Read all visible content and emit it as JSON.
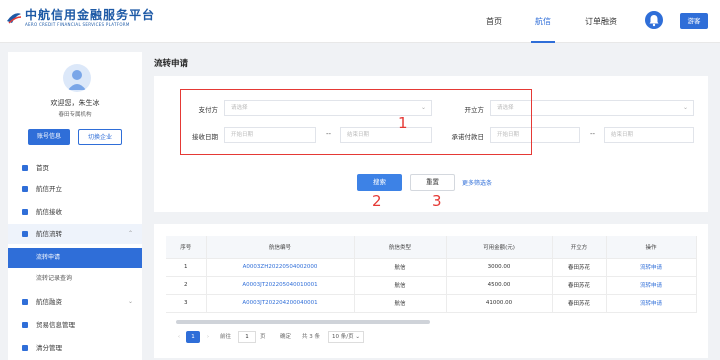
{
  "header": {
    "logo_cn": "中航信用金融服务平台",
    "logo_en": "AERO CREDIT FINANCIAL SERVICES PLATFORM",
    "nav": [
      "首页",
      "航信",
      "订单融资"
    ],
    "active_nav": "航信",
    "top_button": "游客"
  },
  "sidebar": {
    "welcome": "欢迎您，朱生冰",
    "company": "春田专属机构",
    "btn_account": "账号信息",
    "btn_switch": "切换企业",
    "menu": [
      {
        "label": "首页",
        "icon": "home-icon"
      },
      {
        "label": "航信开立",
        "icon": "edit-icon"
      },
      {
        "label": "航信接收",
        "icon": "inbox-icon"
      },
      {
        "label": "航信流转",
        "icon": "transfer-icon",
        "expanded": true
      },
      {
        "label": "流转申请",
        "sub": true,
        "active": true
      },
      {
        "label": "流转记录查询",
        "sub": true
      },
      {
        "label": "航信融资",
        "icon": "finance-icon"
      },
      {
        "label": "贸易信息管理",
        "icon": "trade-icon"
      },
      {
        "label": "清分管理",
        "icon": "settle-icon"
      }
    ]
  },
  "page": {
    "title": "流转申请",
    "form": {
      "payer_label": "支付方",
      "payer_placeholder": "请选择",
      "issuer_label": "开立方",
      "issuer_placeholder": "请选择",
      "receive_date_label": "接收日期",
      "start_placeholder": "开始日期",
      "end_placeholder": "结束日期",
      "pay_date_label": "承诺付款日",
      "range_sep": "--"
    },
    "search_button": "搜索",
    "reset_button": "重置",
    "more_filters": "更多筛选条",
    "annotations": [
      "1",
      "2",
      "3"
    ]
  },
  "table": {
    "headers": [
      "序号",
      "航信编号",
      "航信类型",
      "可用金额(元)",
      "开立方",
      "操作"
    ],
    "rows": [
      [
        "1",
        "A0003ZH20220504002000",
        "航信",
        "3000.00",
        "春田苏花",
        "流转申请"
      ],
      [
        "2",
        "A0003JT202205040010001",
        "航信",
        "4500.00",
        "春田苏花",
        "流转申请"
      ],
      [
        "3",
        "A0003JT202204200040001",
        "航信",
        "41000.00",
        "春田苏花",
        "流转申请"
      ]
    ]
  },
  "pagination": {
    "current": "1",
    "goto_label": "前往",
    "goto_value": "1",
    "page_unit": "页",
    "confirm": "确定",
    "total": "共 3 条",
    "page_size": "10 条/页"
  }
}
